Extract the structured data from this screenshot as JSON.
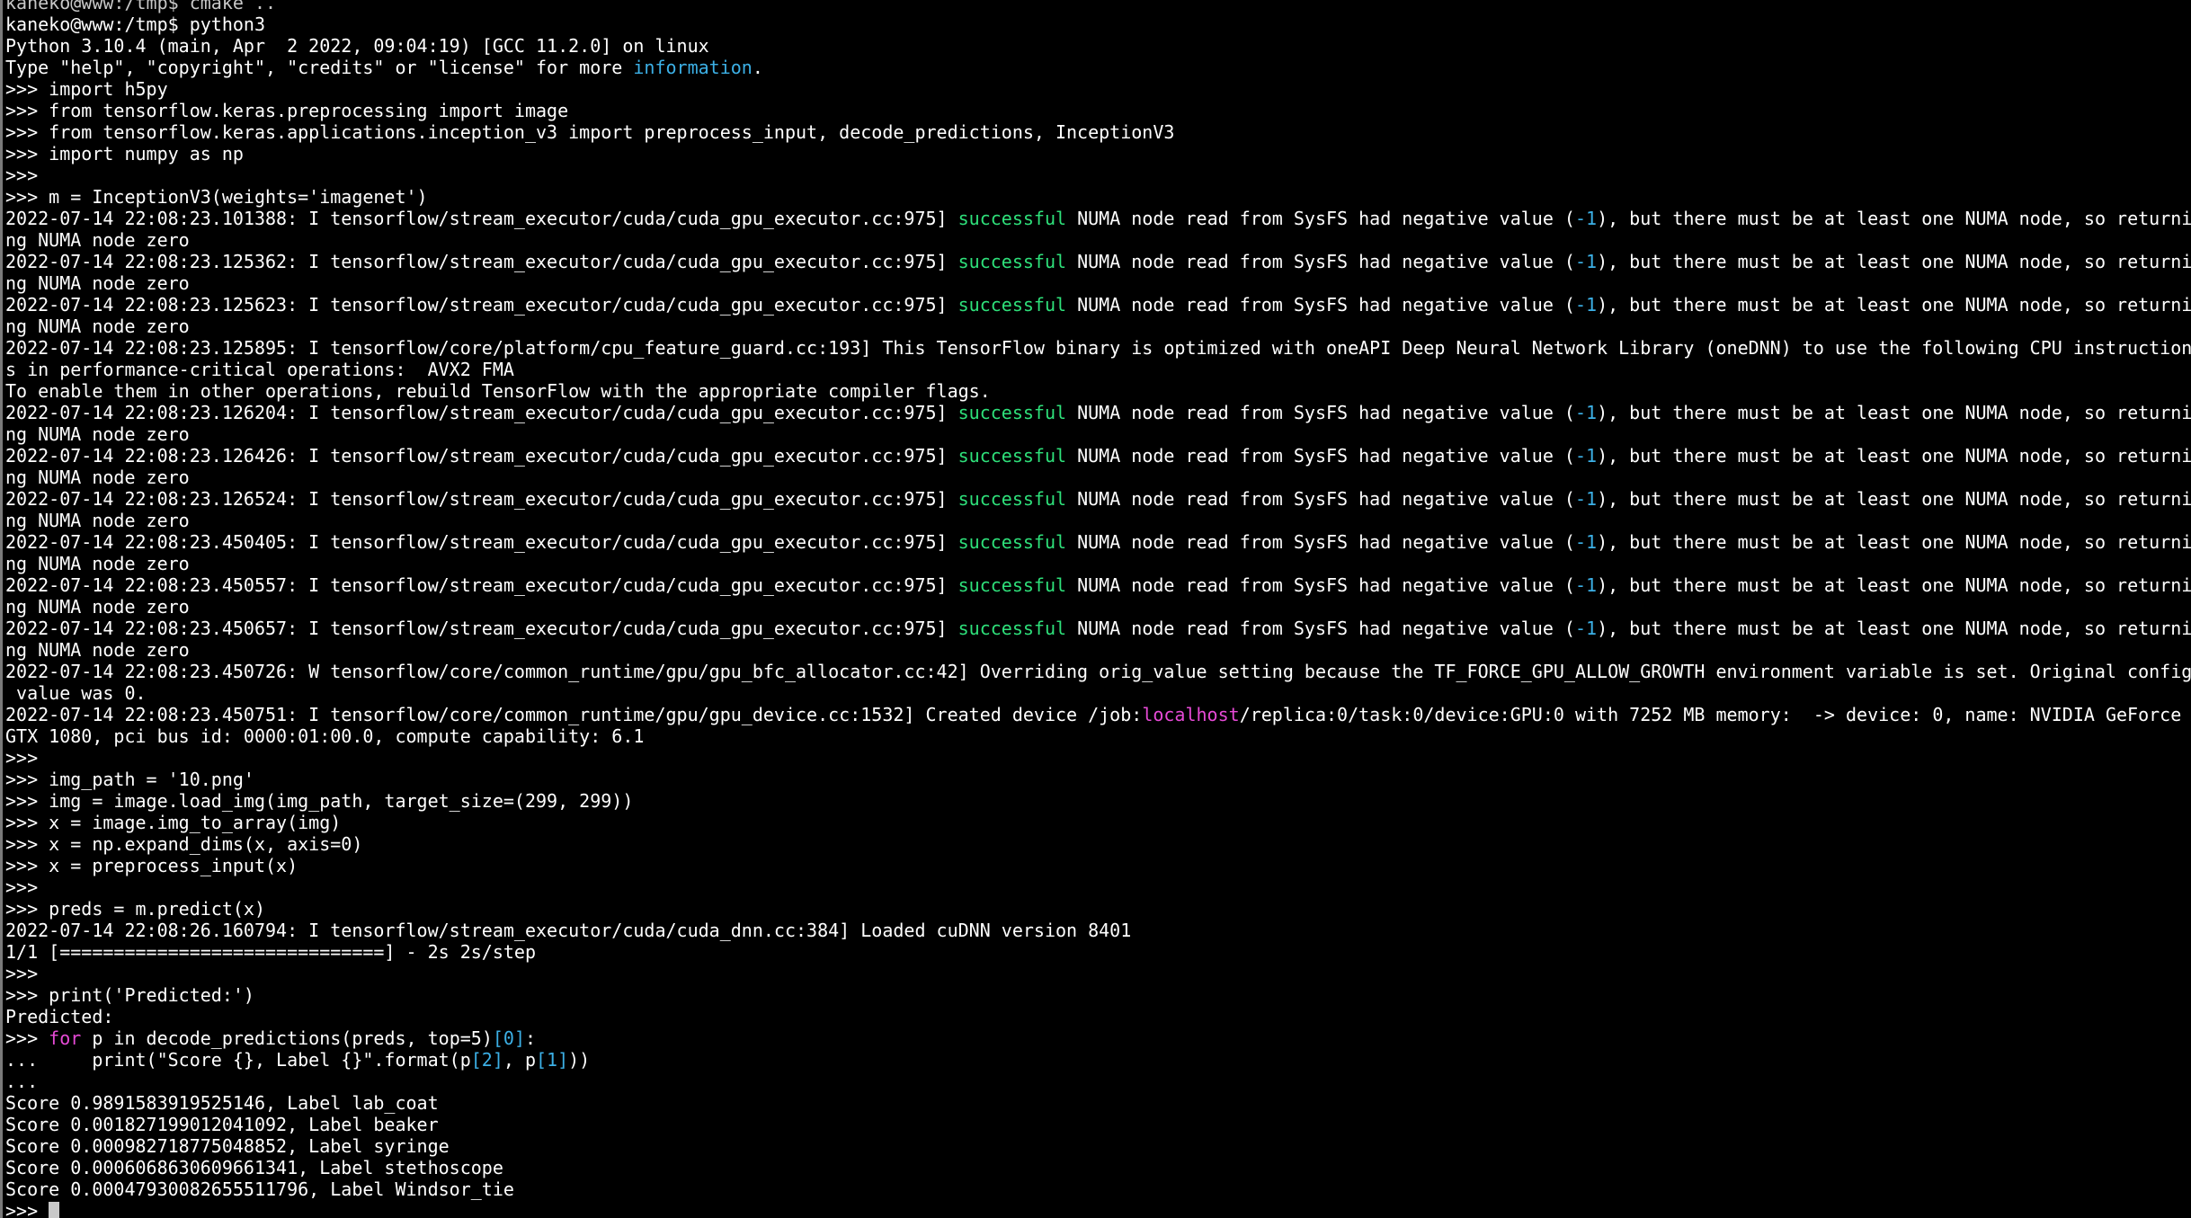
{
  "terminal": {
    "colors": {
      "background": "#000000",
      "text": "#ffffff",
      "green": "#2ee07a",
      "cyan": "#3cb0e6",
      "magenta": "#e64ad6"
    },
    "lines": [
      [
        {
          "t": "kaneko@www:/tmp$ cmake ..",
          "c": "partial"
        }
      ],
      [
        {
          "t": "kaneko@www:/tmp$ python3",
          "c": "white"
        }
      ],
      [
        {
          "t": "Python 3.10.4 (main, Apr  2 2022, 09:04:19) [GCC 11.2.0] on linux",
          "c": "white"
        }
      ],
      [
        {
          "t": "Type \"help\", \"copyright\", \"credits\" or \"license\" for more ",
          "c": "white"
        },
        {
          "t": "information",
          "c": "cyan"
        },
        {
          "t": ".",
          "c": "white"
        }
      ],
      [
        {
          "t": ">>> import h5py",
          "c": "white"
        }
      ],
      [
        {
          "t": ">>> from tensorflow.keras.preprocessing import image",
          "c": "white"
        }
      ],
      [
        {
          "t": ">>> from tensorflow.keras.applications.inception_v3 import preprocess_input, decode_predictions, InceptionV3",
          "c": "white"
        }
      ],
      [
        {
          "t": ">>> import numpy as np",
          "c": "white"
        }
      ],
      [
        {
          "t": ">>>",
          "c": "white"
        }
      ],
      [
        {
          "t": ">>> m = InceptionV3(weights='imagenet')",
          "c": "white"
        }
      ],
      [
        {
          "t": "2022-07-14 22:08:23.101388: I tensorflow/stream_executor/cuda/cuda_gpu_executor.cc:975] ",
          "c": "white"
        },
        {
          "t": "successful",
          "c": "green"
        },
        {
          "t": " NUMA node read from SysFS had negative value (",
          "c": "white"
        },
        {
          "t": "-1",
          "c": "cyan"
        },
        {
          "t": "), but there must be at least one NUMA node, so returni",
          "c": "white"
        }
      ],
      [
        {
          "t": "ng NUMA node zero",
          "c": "white"
        }
      ],
      [
        {
          "t": "2022-07-14 22:08:23.125362: I tensorflow/stream_executor/cuda/cuda_gpu_executor.cc:975] ",
          "c": "white"
        },
        {
          "t": "successful",
          "c": "green"
        },
        {
          "t": " NUMA node read from SysFS had negative value (",
          "c": "white"
        },
        {
          "t": "-1",
          "c": "cyan"
        },
        {
          "t": "), but there must be at least one NUMA node, so returni",
          "c": "white"
        }
      ],
      [
        {
          "t": "ng NUMA node zero",
          "c": "white"
        }
      ],
      [
        {
          "t": "2022-07-14 22:08:23.125623: I tensorflow/stream_executor/cuda/cuda_gpu_executor.cc:975] ",
          "c": "white"
        },
        {
          "t": "successful",
          "c": "green"
        },
        {
          "t": " NUMA node read from SysFS had negative value (",
          "c": "white"
        },
        {
          "t": "-1",
          "c": "cyan"
        },
        {
          "t": "), but there must be at least one NUMA node, so returni",
          "c": "white"
        }
      ],
      [
        {
          "t": "ng NUMA node zero",
          "c": "white"
        }
      ],
      [
        {
          "t": "2022-07-14 22:08:23.125895: I tensorflow/core/platform/cpu_feature_guard.cc:193] This TensorFlow binary is optimized with oneAPI Deep Neural Network Library (oneDNN) to use the following CPU instruction",
          "c": "white"
        }
      ],
      [
        {
          "t": "s in performance-critical operations:  AVX2 FMA",
          "c": "white"
        }
      ],
      [
        {
          "t": "To enable them in other operations, rebuild TensorFlow with the appropriate compiler flags.",
          "c": "white"
        }
      ],
      [
        {
          "t": "2022-07-14 22:08:23.126204: I tensorflow/stream_executor/cuda/cuda_gpu_executor.cc:975] ",
          "c": "white"
        },
        {
          "t": "successful",
          "c": "green"
        },
        {
          "t": " NUMA node read from SysFS had negative value (",
          "c": "white"
        },
        {
          "t": "-1",
          "c": "cyan"
        },
        {
          "t": "), but there must be at least one NUMA node, so returni",
          "c": "white"
        }
      ],
      [
        {
          "t": "ng NUMA node zero",
          "c": "white"
        }
      ],
      [
        {
          "t": "2022-07-14 22:08:23.126426: I tensorflow/stream_executor/cuda/cuda_gpu_executor.cc:975] ",
          "c": "white"
        },
        {
          "t": "successful",
          "c": "green"
        },
        {
          "t": " NUMA node read from SysFS had negative value (",
          "c": "white"
        },
        {
          "t": "-1",
          "c": "cyan"
        },
        {
          "t": "), but there must be at least one NUMA node, so returni",
          "c": "white"
        }
      ],
      [
        {
          "t": "ng NUMA node zero",
          "c": "white"
        }
      ],
      [
        {
          "t": "2022-07-14 22:08:23.126524: I tensorflow/stream_executor/cuda/cuda_gpu_executor.cc:975] ",
          "c": "white"
        },
        {
          "t": "successful",
          "c": "green"
        },
        {
          "t": " NUMA node read from SysFS had negative value (",
          "c": "white"
        },
        {
          "t": "-1",
          "c": "cyan"
        },
        {
          "t": "), but there must be at least one NUMA node, so returni",
          "c": "white"
        }
      ],
      [
        {
          "t": "ng NUMA node zero",
          "c": "white"
        }
      ],
      [
        {
          "t": "2022-07-14 22:08:23.450405: I tensorflow/stream_executor/cuda/cuda_gpu_executor.cc:975] ",
          "c": "white"
        },
        {
          "t": "successful",
          "c": "green"
        },
        {
          "t": " NUMA node read from SysFS had negative value (",
          "c": "white"
        },
        {
          "t": "-1",
          "c": "cyan"
        },
        {
          "t": "), but there must be at least one NUMA node, so returni",
          "c": "white"
        }
      ],
      [
        {
          "t": "ng NUMA node zero",
          "c": "white"
        }
      ],
      [
        {
          "t": "2022-07-14 22:08:23.450557: I tensorflow/stream_executor/cuda/cuda_gpu_executor.cc:975] ",
          "c": "white"
        },
        {
          "t": "successful",
          "c": "green"
        },
        {
          "t": " NUMA node read from SysFS had negative value (",
          "c": "white"
        },
        {
          "t": "-1",
          "c": "cyan"
        },
        {
          "t": "), but there must be at least one NUMA node, so returni",
          "c": "white"
        }
      ],
      [
        {
          "t": "ng NUMA node zero",
          "c": "white"
        }
      ],
      [
        {
          "t": "2022-07-14 22:08:23.450657: I tensorflow/stream_executor/cuda/cuda_gpu_executor.cc:975] ",
          "c": "white"
        },
        {
          "t": "successful",
          "c": "green"
        },
        {
          "t": " NUMA node read from SysFS had negative value (",
          "c": "white"
        },
        {
          "t": "-1",
          "c": "cyan"
        },
        {
          "t": "), but there must be at least one NUMA node, so returni",
          "c": "white"
        }
      ],
      [
        {
          "t": "ng NUMA node zero",
          "c": "white"
        }
      ],
      [
        {
          "t": "2022-07-14 22:08:23.450726: W tensorflow/core/common_runtime/gpu/gpu_bfc_allocator.cc:42] Overriding orig_value setting because the TF_FORCE_GPU_ALLOW_GROWTH environment variable is set. Original config",
          "c": "white"
        }
      ],
      [
        {
          "t": " value was 0.",
          "c": "white"
        }
      ],
      [
        {
          "t": "2022-07-14 22:08:23.450751: I tensorflow/core/common_runtime/gpu/gpu_device.cc:1532] Created device /job:",
          "c": "white"
        },
        {
          "t": "localhost",
          "c": "magenta"
        },
        {
          "t": "/replica:0/task:0/device:GPU:0 with 7252 MB memory:  -> device: 0, name: NVIDIA GeForce",
          "c": "white"
        }
      ],
      [
        {
          "t": "GTX 1080, pci bus id: 0000:01:00.0, compute capability: 6.1",
          "c": "white"
        }
      ],
      [
        {
          "t": ">>>",
          "c": "white"
        }
      ],
      [
        {
          "t": ">>> img_path = '10.png'",
          "c": "white"
        }
      ],
      [
        {
          "t": ">>> img = image.load_img(img_path, target_size=(299, 299))",
          "c": "white"
        }
      ],
      [
        {
          "t": ">>> x = image.img_to_array(img)",
          "c": "white"
        }
      ],
      [
        {
          "t": ">>> x = np.expand_dims(x, axis=0)",
          "c": "white"
        }
      ],
      [
        {
          "t": ">>> x = preprocess_input(x)",
          "c": "white"
        }
      ],
      [
        {
          "t": ">>>",
          "c": "white"
        }
      ],
      [
        {
          "t": ">>> preds = m.predict(x)",
          "c": "white"
        }
      ],
      [
        {
          "t": "2022-07-14 22:08:26.160794: I tensorflow/stream_executor/cuda/cuda_dnn.cc:384] Loaded cuDNN version 8401",
          "c": "white"
        }
      ],
      [
        {
          "t": "1/1 [==============================] - 2s 2s/step",
          "c": "white"
        }
      ],
      [
        {
          "t": ">>>",
          "c": "white"
        }
      ],
      [
        {
          "t": ">>> print('Predicted:')",
          "c": "white"
        }
      ],
      [
        {
          "t": "Predicted:",
          "c": "white"
        }
      ],
      [
        {
          "t": ">>> ",
          "c": "white"
        },
        {
          "t": "for",
          "c": "magenta"
        },
        {
          "t": " p in decode_predictions(preds, top=5)",
          "c": "white"
        },
        {
          "t": "[0]",
          "c": "cyan"
        },
        {
          "t": ":",
          "c": "white"
        }
      ],
      [
        {
          "t": "...     print(\"Score {}, Label {}\".format(p",
          "c": "white"
        },
        {
          "t": "[2]",
          "c": "cyan"
        },
        {
          "t": ", p",
          "c": "white"
        },
        {
          "t": "[1]",
          "c": "cyan"
        },
        {
          "t": "))",
          "c": "white"
        }
      ],
      [
        {
          "t": "...",
          "c": "white"
        }
      ],
      [
        {
          "t": "Score 0.9891583919525146, Label lab_coat",
          "c": "white"
        }
      ],
      [
        {
          "t": "Score 0.001827199012041092, Label beaker",
          "c": "white"
        }
      ],
      [
        {
          "t": "Score 0.000982718775048852, Label syringe",
          "c": "white"
        }
      ],
      [
        {
          "t": "Score 0.0006068630609661341, Label stethoscope",
          "c": "white"
        }
      ],
      [
        {
          "t": "Score 0.00047930082655511796, Label Windsor_tie",
          "c": "white"
        }
      ]
    ],
    "prompt": ">>> "
  }
}
